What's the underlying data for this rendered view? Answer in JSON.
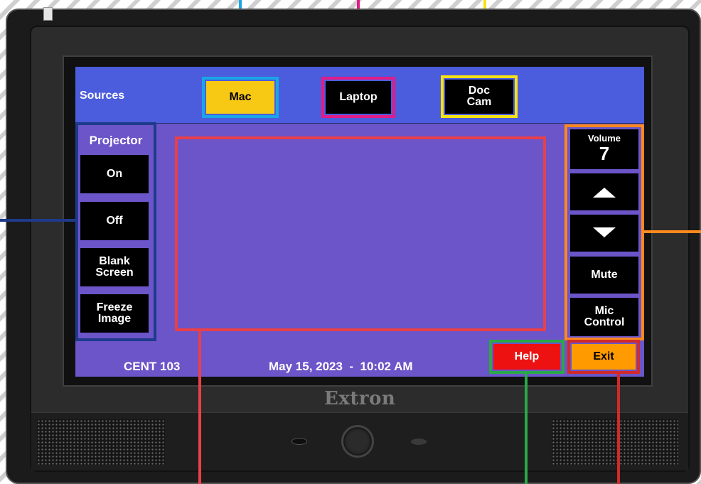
{
  "header": {
    "sources_label": "Sources"
  },
  "sources": [
    {
      "label": "Mac",
      "color": "#f7c814"
    },
    {
      "label": "Laptop",
      "color": "#000000"
    },
    {
      "label": "Doc\nCam",
      "color": "#000000"
    }
  ],
  "projector": {
    "title": "Projector",
    "buttons": [
      "On",
      "Off",
      "Blank\nScreen",
      "Freeze\nImage"
    ]
  },
  "volume": {
    "label": "Volume",
    "value": "7",
    "mute_label": "Mute",
    "mic_label": "Mic\nControl"
  },
  "footer": {
    "room": "CENT 103",
    "datetime": "May 15, 2023  -  10:02 AM",
    "help_label": "Help",
    "exit_label": "Exit"
  },
  "brand": "Extron",
  "colors": {
    "screen_bg": "#6b55c8",
    "topbar_bg": "#4b5cdc",
    "mac_highlight": "#1aa6e6",
    "laptop_highlight": "#e01c8a",
    "doccam_highlight": "#f7e214",
    "projector_highlight": "#1f3a8a",
    "volume_highlight": "#ff8a1c",
    "preview_highlight": "#e8404a",
    "help_highlight": "#2aa84a",
    "exit_highlight": "#d12a2a",
    "help_bg": "#ee1111",
    "exit_bg": "#ff9a00"
  }
}
